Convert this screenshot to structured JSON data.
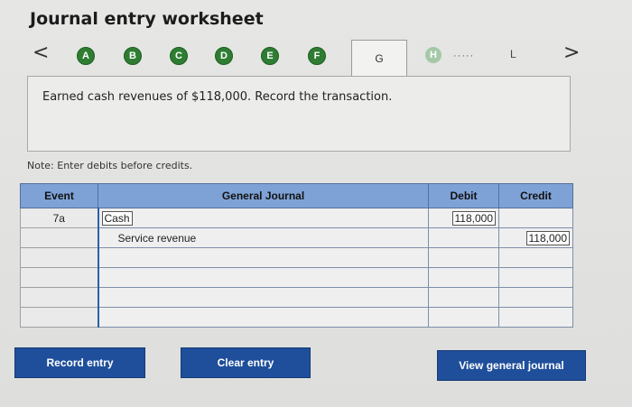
{
  "header": {
    "title": "Journal entry worksheet"
  },
  "nav": {
    "prev_label": "<",
    "next_label": ">",
    "steps": [
      "A",
      "B",
      "C",
      "D",
      "E",
      "F"
    ],
    "current_tab": "G",
    "next_step": "H",
    "dots": "·····",
    "last_label": "L"
  },
  "prompt": {
    "text": "Earned cash revenues of $118,000. Record the transaction."
  },
  "note": "Note: Enter debits before credits.",
  "table": {
    "headers": {
      "event": "Event",
      "journal": "General Journal",
      "debit": "Debit",
      "credit": "Credit"
    },
    "rows": [
      {
        "event": "7a",
        "account": "Cash",
        "debit": "118,000",
        "credit": ""
      },
      {
        "event": "",
        "account": "Service revenue",
        "debit": "",
        "credit": "118,000"
      },
      {
        "event": "",
        "account": "",
        "debit": "",
        "credit": ""
      },
      {
        "event": "",
        "account": "",
        "debit": "",
        "credit": ""
      },
      {
        "event": "",
        "account": "",
        "debit": "",
        "credit": ""
      },
      {
        "event": "",
        "account": "",
        "debit": "",
        "credit": ""
      }
    ]
  },
  "buttons": {
    "record": "Record entry",
    "clear": "Clear entry",
    "view": "View general journal"
  },
  "colors": {
    "step_green": "#2e7d32",
    "header_blue": "#7ea2d6",
    "button_blue": "#1f4f9b"
  }
}
